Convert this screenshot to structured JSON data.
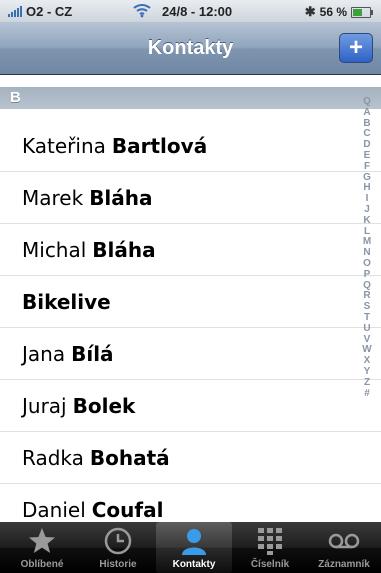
{
  "status": {
    "carrier": "O2 - CZ",
    "datetime": "24/8 - 12:00",
    "battery": "56 %",
    "battery_level": 0.56
  },
  "navbar": {
    "title": "Kontakty",
    "add_label": "+"
  },
  "section": {
    "letter": "B"
  },
  "contacts": [
    {
      "first": "Kateřina",
      "last": "Bartlová"
    },
    {
      "first": "Marek",
      "last": "Bláha"
    },
    {
      "first": "Michal",
      "last": "Bláha"
    },
    {
      "first": "",
      "last": "Bikelive"
    },
    {
      "first": "Jana",
      "last": "Bílá"
    },
    {
      "first": "Juraj",
      "last": "Bolek"
    },
    {
      "first": "Radka",
      "last": "Bohatá"
    },
    {
      "first": "Daniel",
      "last": "Coufal"
    }
  ],
  "index": {
    "search_glyph": "Q",
    "letters": [
      "A",
      "B",
      "C",
      "D",
      "E",
      "F",
      "G",
      "H",
      "I",
      "J",
      "K",
      "L",
      "M",
      "N",
      "O",
      "P",
      "Q",
      "R",
      "S",
      "T",
      "U",
      "V",
      "W",
      "X",
      "Y",
      "Z",
      "#"
    ]
  },
  "tabs": [
    {
      "label": "Oblíbené",
      "icon": "star-icon",
      "active": false
    },
    {
      "label": "Historie",
      "icon": "clock-icon",
      "active": false
    },
    {
      "label": "Kontakty",
      "icon": "person-icon",
      "active": true
    },
    {
      "label": "Číselník",
      "icon": "keypad-icon",
      "active": false
    },
    {
      "label": "Záznamník",
      "icon": "voicemail-icon",
      "active": false
    }
  ],
  "colors": {
    "accent": "#2f62c7",
    "tab_active_icon": "#3a9be8"
  }
}
